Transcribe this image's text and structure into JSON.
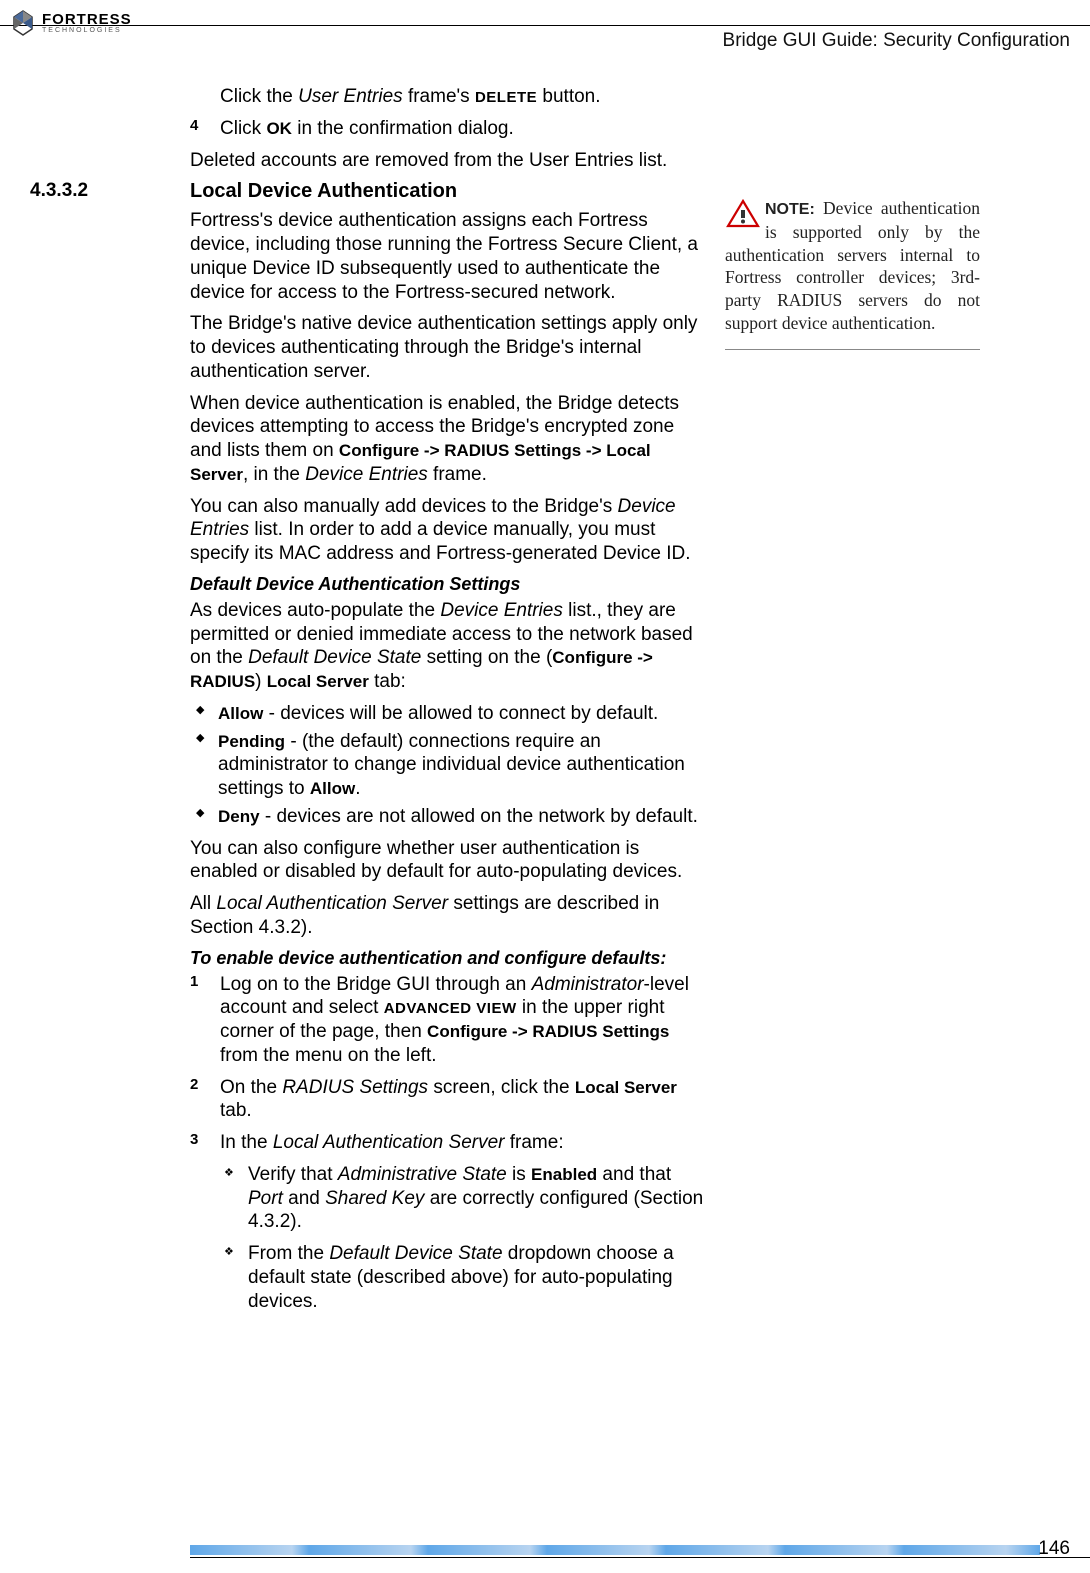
{
  "header": {
    "logo_main": "FORTRESS",
    "logo_sub": "TECHNOLOGIES",
    "doc_title": "Bridge GUI Guide: Security Configuration"
  },
  "content": {
    "pre_step3": "Click the User Entries frame's DELETE button.",
    "step4_num": "4",
    "step4": "Click OK in the confirmation dialog.",
    "post_step4": "Deleted accounts are removed from the User Entries list.",
    "sec_num": "4.3.3.2",
    "sec_title": "Local Device Authentication",
    "p1": "Fortress's device authentication assigns each Fortress device, including those running the Fortress Secure Client, a unique Device ID subsequently used to authenticate the device for access to the Fortress-secured network.",
    "p2": "The Bridge's native device authentication settings apply only to devices authenticating through the Bridge's internal authentication server.",
    "p3_a": "When device authentication is enabled, the Bridge detects devices attempting to access the Bridge's encrypted zone and lists them on ",
    "p3_b": "Configure -> RADIUS Settings -> Local Server",
    "p3_c": ", in the Device Entries frame.",
    "p4": "You can also manually add devices to the Bridge's Device Entries list. In order to add a device manually, you must specify its MAC address and Fortress-generated Device ID.",
    "h4_1": "Default Device Authentication Settings",
    "p5_a": "As devices auto-populate the Device Entries list., they are permitted or denied immediate access to the network based on the Default Device State setting on the (",
    "p5_b": "Configure -> RADIUS",
    "p5_c": ") ",
    "p5_d": "Local Server",
    "p5_e": " tab:",
    "bullets": [
      {
        "term": "Allow",
        "desc": " - devices will be allowed to connect by default."
      },
      {
        "term": "Pending",
        "desc": " - (the default) connections require an administrator to change individual device authentication settings to Allow."
      },
      {
        "term": "Deny",
        "desc": " - devices are not allowed on the network by default."
      }
    ],
    "p6": "You can also configure whether user authentication is enabled or disabled by default for auto-populating devices.",
    "p7": "All Local Authentication Server settings are described in Section 4.3.2).",
    "h4_2": "To enable device authentication and configure defaults:",
    "steps2": [
      {
        "num": "1",
        "a": "Log on to the Bridge GUI through an Administrator-level account and select ",
        "b": "ADVANCED VIEW",
        "c": " in the upper right corner of the page, then ",
        "d": "Configure -> RADIUS Settings",
        "e": " from the menu on the left."
      },
      {
        "num": "2",
        "a": "On the RADIUS Settings screen, click the ",
        "b": "Local Server",
        "c": " tab."
      },
      {
        "num": "3",
        "a": "In the Local Authentication Server frame:"
      }
    ],
    "sub_bullets": [
      {
        "a": "Verify that Administrative State is ",
        "b": "Enabled",
        "c": " and that Port and Shared Key are correctly configured (Section 4.3.2)."
      },
      {
        "a": "From the Default Device State dropdown choose a default state (described above) for auto-populating devices."
      }
    ]
  },
  "note": {
    "label": "NOTE:",
    "text": " Device authentication is supported only by the authentication servers internal to Fortress controller devices; 3rd-party RADIUS servers do not support device authentication."
  },
  "footer": {
    "page_num": "146"
  }
}
